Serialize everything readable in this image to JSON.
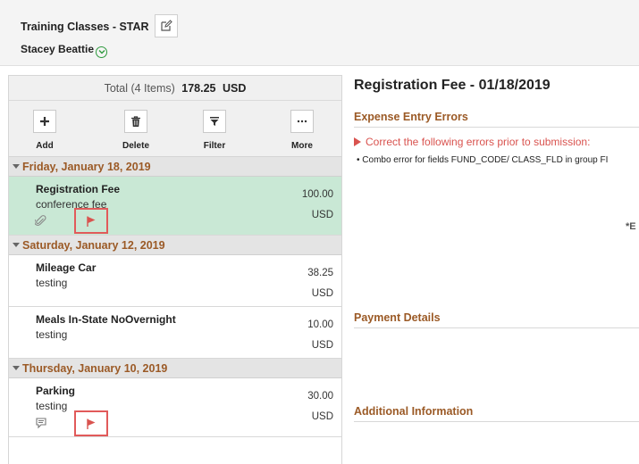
{
  "header": {
    "title": "Training Classes - STAR",
    "user": "Stacey Beattie"
  },
  "summary": {
    "total_label": "Total (4 Items)",
    "total_amount": "178.25",
    "total_currency": "USD"
  },
  "toolbar": {
    "add": "Add",
    "delete": "Delete",
    "filter": "Filter",
    "more": "More"
  },
  "groups": [
    {
      "date": "Friday, January 18, 2019",
      "items": [
        {
          "name": "Registration Fee",
          "desc": "conference fee",
          "amount": "100.00",
          "currency": "USD"
        }
      ]
    },
    {
      "date": "Saturday, January 12, 2019",
      "items": [
        {
          "name": "Mileage Car",
          "desc": "testing",
          "amount": "38.25",
          "currency": "USD"
        },
        {
          "name": "Meals In-State NoOvernight",
          "desc": "testing",
          "amount": "10.00",
          "currency": "USD"
        }
      ]
    },
    {
      "date": "Thursday, January 10, 2019",
      "items": [
        {
          "name": "Parking",
          "desc": "testing",
          "amount": "30.00",
          "currency": "USD"
        }
      ]
    }
  ],
  "detail": {
    "title": "Registration Fee - 01/18/2019",
    "errors_heading": "Expense Entry Errors",
    "error_message": "Correct the following errors prior to submission:",
    "error_item": "Combo error for fields FUND_CODE/ CLASS_FLD in group FI",
    "required_marker": "*E",
    "payment_heading": "Payment Details",
    "additional_heading": "Additional Information"
  },
  "colors": {
    "section_heading": "#9b5a26",
    "selected_row": "#c9e8d5",
    "error": "#d9534f",
    "flag_highlight": "#e15a5a"
  }
}
